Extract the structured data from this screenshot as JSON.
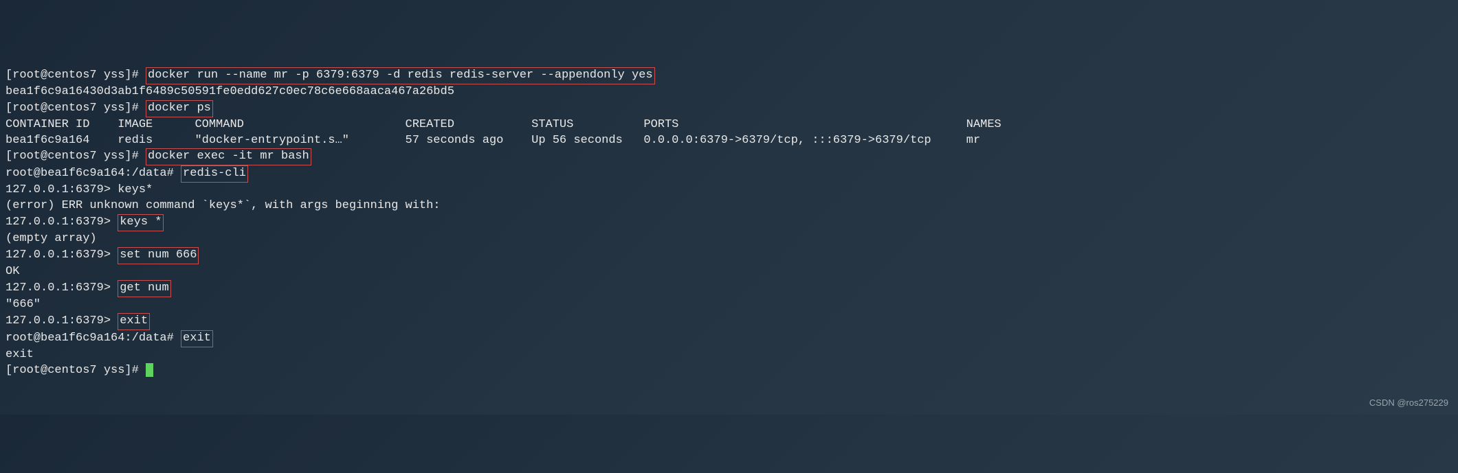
{
  "lines": [
    {
      "prompt": "[root@centos7 yss]# ",
      "cmd": "docker run --name mr -p 6379:6379 -d redis redis-server --appendonly yes",
      "highlighted": true
    },
    {
      "text": "bea1f6c9a16430d3ab1f6489c50591fe0edd627c0ec78c6e668aaca467a26bd5"
    },
    {
      "prompt": "[root@centos7 yss]# ",
      "cmd": "docker ps",
      "highlighted": true
    },
    {
      "header": true,
      "cols": [
        "CONTAINER ID",
        "IMAGE",
        "COMMAND",
        "CREATED",
        "STATUS",
        "PORTS",
        "NAMES"
      ]
    },
    {
      "row": true,
      "cols": [
        "bea1f6c9a164",
        "redis",
        "\"docker-entrypoint.s…\"",
        "57 seconds ago",
        "Up 56 seconds",
        "0.0.0.0:6379->6379/tcp, :::6379->6379/tcp",
        "mr"
      ]
    },
    {
      "prompt": "[root@centos7 yss]# ",
      "cmd": "docker exec -it mr bash",
      "highlighted": true
    },
    {
      "prompt": "root@bea1f6c9a164:/data# ",
      "cmd": "redis-cli",
      "highlighted": true
    },
    {
      "prompt": "127.0.0.1:6379> ",
      "cmd": "keys*",
      "highlightPrompt": false
    },
    {
      "text": "(error) ERR unknown command `keys*`, with args beginning with:"
    },
    {
      "prompt": "127.0.0.1:6379> ",
      "cmd": "keys *",
      "highlighted": true
    },
    {
      "text": "(empty array)"
    },
    {
      "prompt": "127.0.0.1:6379> ",
      "cmd": "set num 666",
      "highlighted": true
    },
    {
      "text": "OK"
    },
    {
      "prompt": "127.0.0.1:6379> ",
      "cmd": "get num",
      "highlighted": true
    },
    {
      "text": "\"666\""
    },
    {
      "prompt": "127.0.0.1:6379> ",
      "cmd": "exit",
      "highlighted": true
    },
    {
      "prompt": "root@bea1f6c9a164:/data# ",
      "cmd": "exit",
      "highlighted": true
    },
    {
      "text": "exit"
    },
    {
      "prompt": "[root@centos7 yss]# ",
      "cmd": "",
      "cursor": true
    }
  ],
  "watermark": "CSDN @ros275229"
}
